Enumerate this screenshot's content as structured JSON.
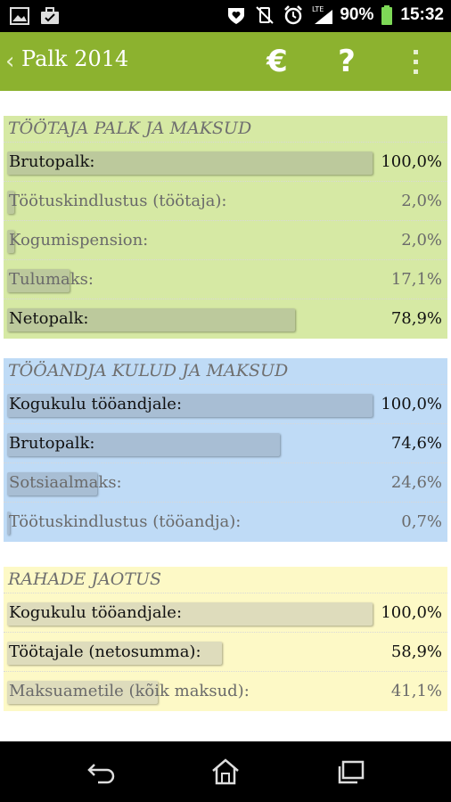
{
  "status_bar": {
    "battery_percent": "90%",
    "time": "15:32",
    "network": "LTE",
    "icons": [
      "image-icon",
      "briefcase-icon",
      "shield-heart-icon",
      "vibrate-off-icon",
      "alarm-icon",
      "lte-icon",
      "signal-icon",
      "battery-icon"
    ]
  },
  "action_bar": {
    "title": "Palk 2014",
    "euro_label": "€",
    "help_label": "?",
    "color": "#8cb22f"
  },
  "sections": [
    {
      "title": "TÖÖTAJA PALK JA MAKSUD",
      "color": "#d6e9a4",
      "rows": [
        {
          "label": "Brutopalk:",
          "value": "100,0%",
          "fraction": 1.0
        },
        {
          "label": "Töötuskindlustus (töötaja):",
          "value": "2,0%",
          "fraction": 0.02
        },
        {
          "label": "Kogumispension:",
          "value": "2,0%",
          "fraction": 0.02
        },
        {
          "label": "Tulumaks:",
          "value": "17,1%",
          "fraction": 0.171
        },
        {
          "label": "Netopalk:",
          "value": "78,9%",
          "fraction": 0.789
        }
      ]
    },
    {
      "title": "TÖÖANDJA KULUD JA MAKSUD",
      "color": "#bfdbf6",
      "rows": [
        {
          "label": "Kogukulu tööandjale:",
          "value": "100,0%",
          "fraction": 1.0
        },
        {
          "label": "Brutopalk:",
          "value": "74,6%",
          "fraction": 0.746
        },
        {
          "label": "Sotsiaalmaks:",
          "value": "24,6%",
          "fraction": 0.246
        },
        {
          "label": "Töötuskindlustus (tööandja):",
          "value": "0,7%",
          "fraction": 0.007
        }
      ]
    },
    {
      "title": "RAHADE JAOTUS",
      "color": "#fdf9c6",
      "rows": [
        {
          "label": "Kogukulu tööandjale:",
          "value": "100,0%",
          "fraction": 1.0
        },
        {
          "label": "Töötajale (netosumma):",
          "value": "58,9%",
          "fraction": 0.589
        },
        {
          "label": "Maksuametile (kõik maksud):",
          "value": "41,1%",
          "fraction": 0.411
        }
      ]
    }
  ],
  "nav_bar": {
    "icons": [
      "back-icon",
      "home-icon",
      "recents-icon"
    ]
  }
}
